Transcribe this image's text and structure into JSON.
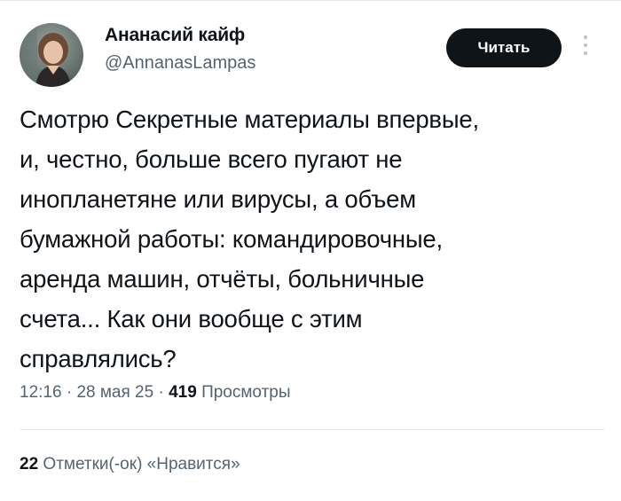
{
  "author": {
    "display_name": "Ананасий кайф",
    "handle": "@AnnanasLampas",
    "avatar_icon": "user-avatar"
  },
  "header": {
    "read_button_label": "Читать",
    "more_icon": "more-vertical-icon"
  },
  "tweet": {
    "text": "Смотрю Секретные материалы впервые,\nи, честно, больше всего пугают не\nинопланетяне или вирусы, а объем\nбумажной работы: командировочные,\nаренда машин, отчёты, больничные\nсчета... Как они вообще с этим\nсправлялись?"
  },
  "meta": {
    "time": "12:16",
    "sep1": " · ",
    "date": "28 мая 25",
    "sep2": " · ",
    "views_count": "419",
    "views_label": "Просмотры"
  },
  "engagement": {
    "likes_count": "22",
    "likes_label": "Отметки(-ок) «Нравится»"
  },
  "colors": {
    "text_primary": "#0f1419",
    "text_secondary": "#536471",
    "button_bg": "#0f1419",
    "divider": "#e6e9ec"
  }
}
